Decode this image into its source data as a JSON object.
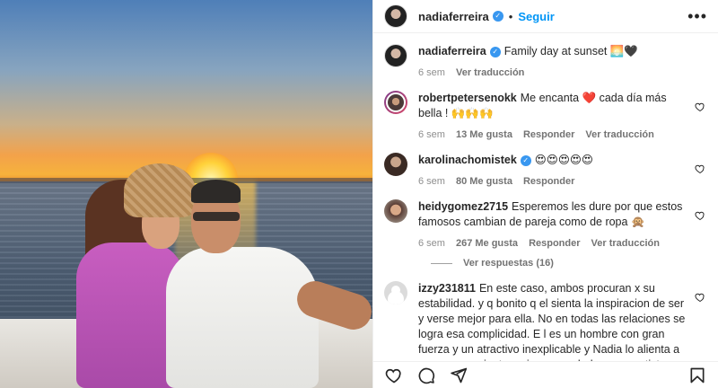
{
  "header": {
    "username": "nadiaferreira",
    "separator": "•",
    "follow_label": "Seguir",
    "more_label": "•••"
  },
  "caption": {
    "username": "nadiaferreira",
    "text": "Family day at sunset 🌅🖤",
    "time": "6 sem",
    "translate": "Ver traducción"
  },
  "comments": [
    {
      "username": "robertpetersenokk",
      "text": "Me encanta ❤️ cada día más bella ! 🙌🙌🙌",
      "time": "6 sem",
      "likes": "13 Me gusta",
      "reply": "Responder",
      "translate": "Ver traducción",
      "verified": false
    },
    {
      "username": "karolinachomistek",
      "text": "😍😍😍😍😍",
      "time": "6 sem",
      "likes": "80 Me gusta",
      "reply": "Responder",
      "verified": true
    },
    {
      "username": "heidygomez2715",
      "text": "Esperemos les dure por que estos famosos cambian de pareja como de ropa 🙊",
      "time": "6 sem",
      "likes": "267 Me gusta",
      "reply": "Responder",
      "translate": "Ver traducción",
      "verified": false
    }
  ],
  "view_replies": "Ver respuestas (16)",
  "last_comment": {
    "username": "izzy231811",
    "text": "En este caso, ambos procuran x su estabilidad. y q bonito q el sienta la inspiracion de ser y verse mejor para ella. No en todas las relaciones se logra esa complicidad. E l es un hombre con gran fuerza y un atractivo inexplicable y Nadia lo alienta a se vea y se sienta mejor x su salud y como artista y esposo de una atractiva, famosa e inteligente chica."
  },
  "colors": {
    "accent": "#0095f6",
    "verified": "#3897f0",
    "muted": "#8e8e8e"
  },
  "icons": [
    "heart-icon",
    "comment-icon",
    "share-icon",
    "bookmark-icon",
    "more-icon",
    "verified-icon"
  ]
}
